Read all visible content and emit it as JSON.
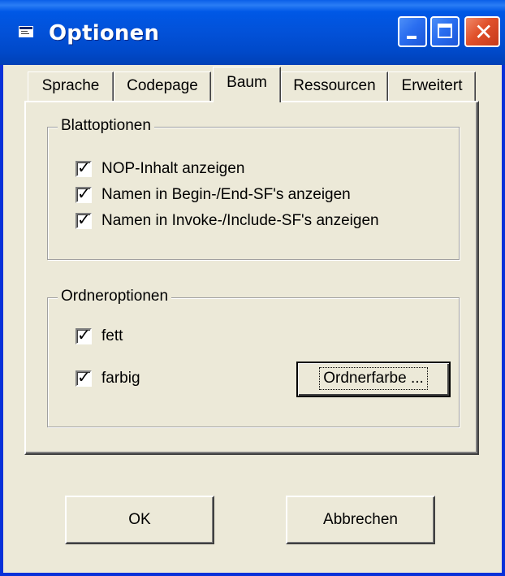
{
  "window": {
    "title": "Optionen"
  },
  "titlebar_buttons": {
    "minimize_icon": "minimize-icon",
    "maximize_icon": "maximize-icon",
    "close_glyph": "✕"
  },
  "tabs": [
    {
      "label": "Sprache",
      "active": false
    },
    {
      "label": "Codepage",
      "active": false
    },
    {
      "label": "Baum",
      "active": true
    },
    {
      "label": "Ressourcen",
      "active": false
    },
    {
      "label": "Erweitert",
      "active": false
    }
  ],
  "blattoptionen": {
    "legend": "Blattoptionen",
    "options": [
      {
        "label": "NOP-Inhalt anzeigen",
        "checked": true
      },
      {
        "label": "Namen in Begin-/End-SF's anzeigen",
        "checked": true
      },
      {
        "label": "Namen in Invoke-/Include-SF's anzeigen",
        "checked": true
      }
    ]
  },
  "ordneroptionen": {
    "legend": "Ordneroptionen",
    "options": [
      {
        "label": "fett",
        "checked": true
      },
      {
        "label": "farbig",
        "checked": true
      }
    ],
    "color_button": "Ordnerfarbe ..."
  },
  "footer": {
    "ok_label": "OK",
    "cancel_label": "Abbrechen"
  },
  "check_glyph": "✓"
}
